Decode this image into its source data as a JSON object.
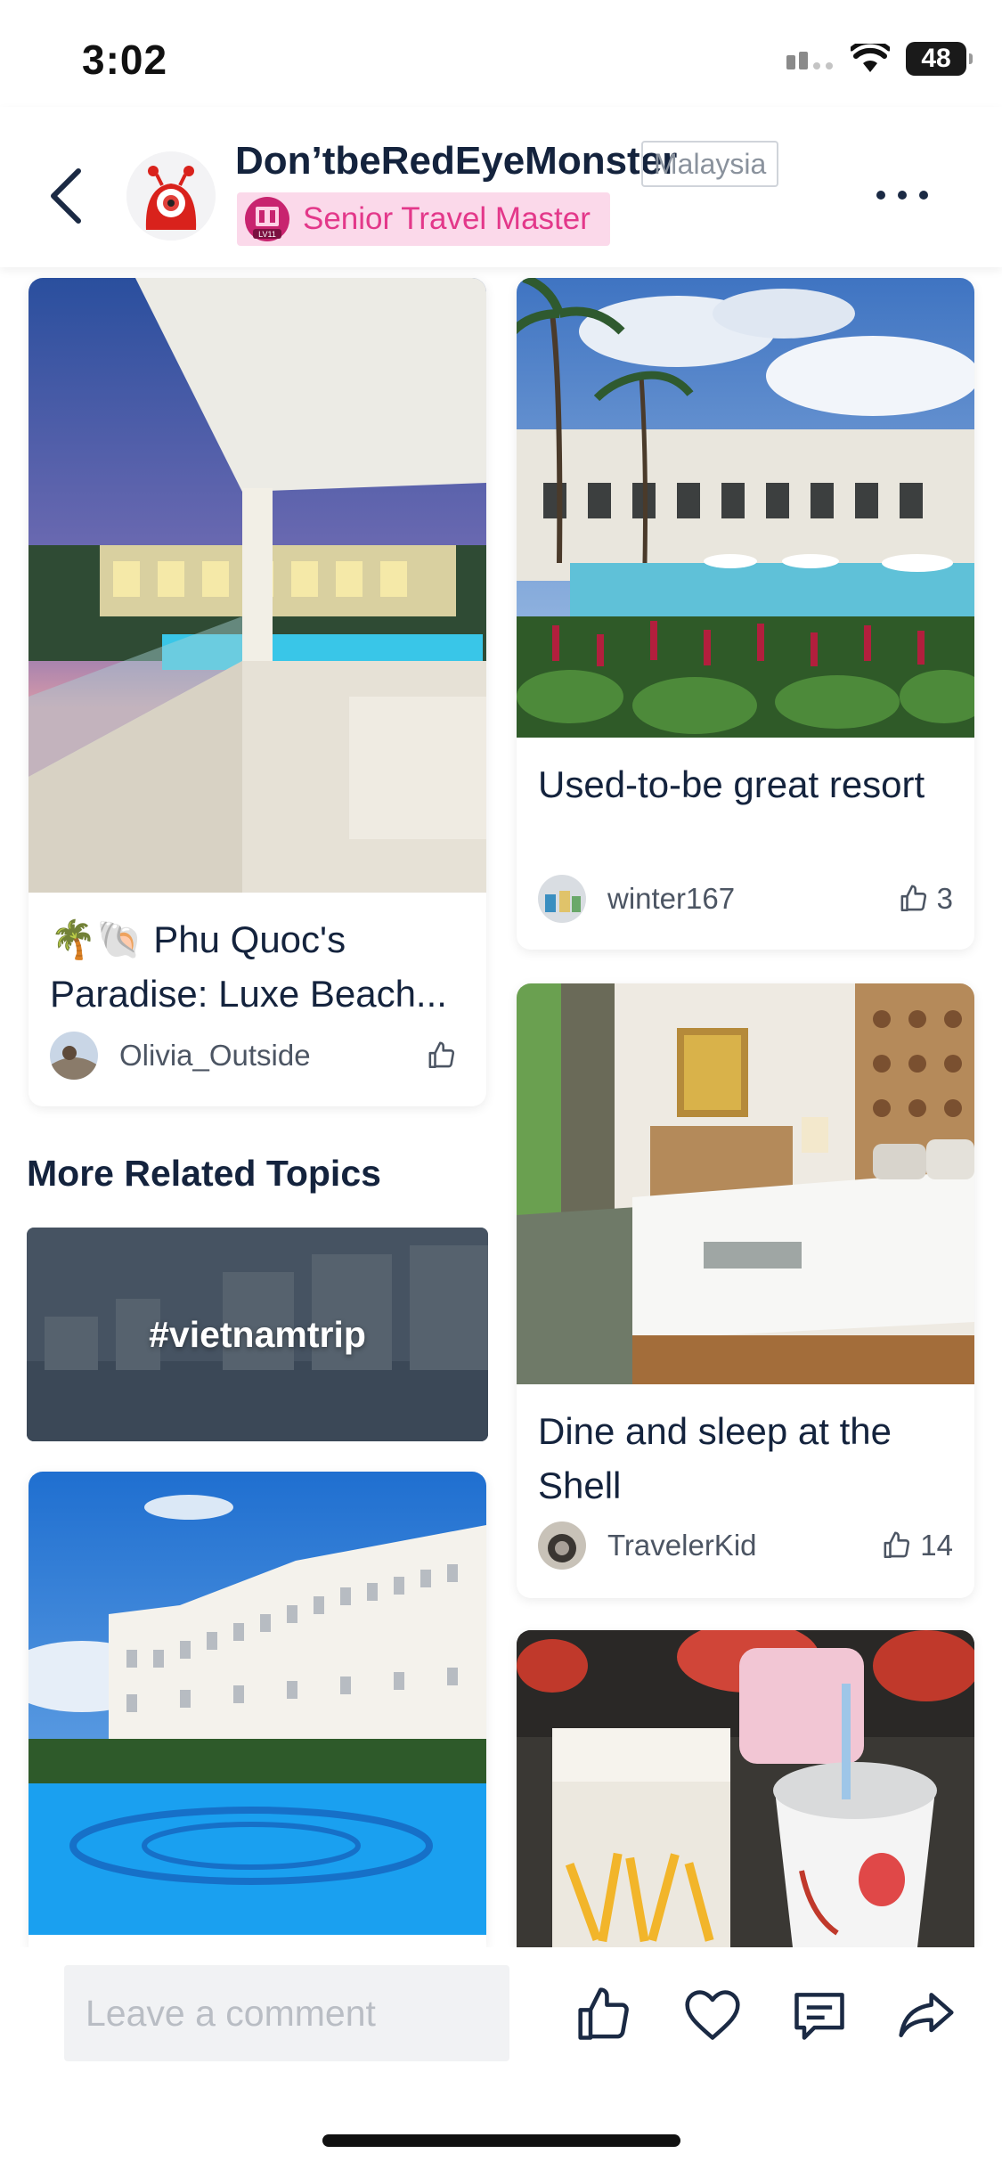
{
  "status_bar": {
    "time": "3:02",
    "battery": "48"
  },
  "header": {
    "user_name": "Don’tbeRedEyeMonster",
    "country": "Malaysia",
    "level_badge_label": "Senior Travel Master",
    "level_badge_icon_text": "LV11"
  },
  "posts": [
    {
      "title": "🌴🐚 Phu Quoc's Paradise: Luxe Beach...",
      "author": "Olivia_Outside",
      "likes": ""
    },
    {
      "title": "Used-to-be great resort",
      "author": "winter167",
      "likes": "3"
    },
    {
      "title": "Dine and sleep at the Shell",
      "author": "TravelerKid",
      "likes": "14"
    }
  ],
  "related": {
    "section_title": "More Related Topics",
    "topics": [
      {
        "label": "#vietnamtrip"
      }
    ]
  },
  "bottom_bar": {
    "comment_placeholder": "Leave a comment"
  },
  "icons": {
    "back": "chevron-left-icon",
    "more": "ellipsis-icon",
    "like": "thumbs-up-icon",
    "favorite": "heart-icon",
    "comment": "comment-icon",
    "share": "share-arrow-icon"
  },
  "colors": {
    "primary_text": "#14233d",
    "badge_pink_bg": "#fbd9ea",
    "badge_pink_text": "#e3388a"
  }
}
